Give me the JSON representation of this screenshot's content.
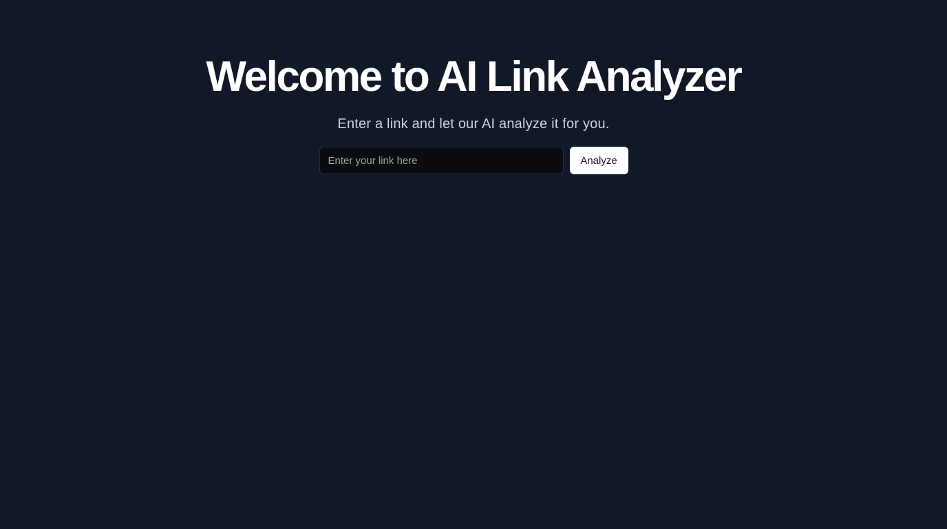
{
  "hero": {
    "title": "Welcome to AI Link Analyzer",
    "subtitle": "Enter a link and let our AI analyze it for you."
  },
  "form": {
    "link_input": {
      "value": "",
      "placeholder": "Enter your link here"
    },
    "analyze_label": "Analyze"
  },
  "colors": {
    "background": "#111827",
    "title": "#ffffff",
    "subtitle": "#cbd5e1",
    "input_background": "#0a0b0f",
    "button_background": "#ffffff",
    "button_text": "#111827"
  }
}
